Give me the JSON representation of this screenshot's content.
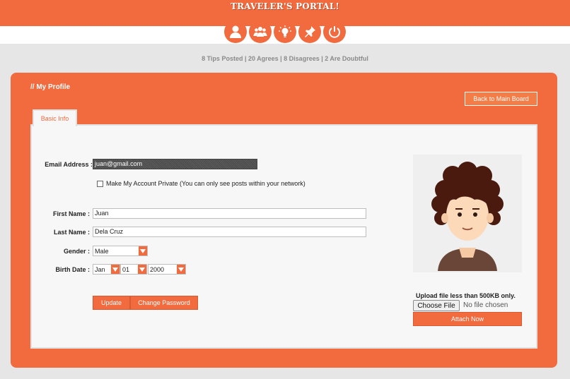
{
  "header": {
    "brand": "TRAVELER'S PORTAL!",
    "nav": [
      {
        "icon": "user-icon"
      },
      {
        "icon": "group-icon"
      },
      {
        "icon": "lightbulb-icon"
      },
      {
        "icon": "pin-icon"
      },
      {
        "icon": "power-icon"
      }
    ],
    "stats": "8 Tips Posted | 20 Agrees | 8 Disagrees | 2 Are Doubtful"
  },
  "profile": {
    "title": "// My Profile",
    "back_label": "Back to Main Board",
    "tab_label": "Basic Info",
    "email_label": "Email Address :",
    "email_value": "juan@gmail.com",
    "private_label": "Make My Account Private (You can only see posts within your network)",
    "first_name_label": "First Name :",
    "first_name_value": "Juan",
    "last_name_label": "Last Name :",
    "last_name_value": "Dela Cruz",
    "gender_label": "Gender :",
    "gender_value": "Male",
    "birth_label": "Birth Date :",
    "birth_month": "Jan",
    "birth_day": "01",
    "birth_year": "2000",
    "update_label": "Update",
    "change_password_label": "Change Password",
    "upload_note": "Upload file less than 500KB only.",
    "choose_file_label": "Choose File",
    "file_status": "No file chosen",
    "attach_label": "Attach Now"
  },
  "colors": {
    "accent": "#f26b3f",
    "page_bg": "#e6e6e6",
    "panel_bg": "#f7f7f7"
  }
}
